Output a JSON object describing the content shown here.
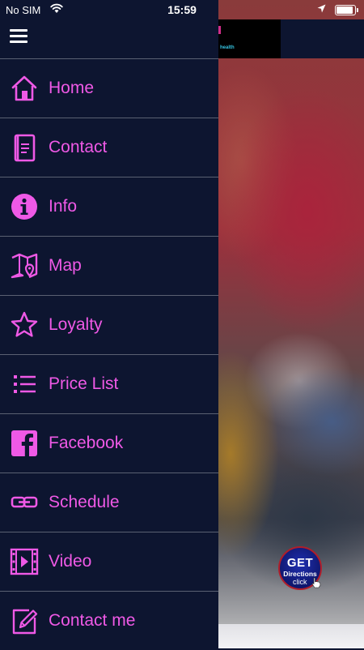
{
  "status_bar": {
    "carrier": "No SIM",
    "time": "15:59",
    "battery_level": 0.9
  },
  "header": {
    "logo_text": "health"
  },
  "drawer": {
    "menu_icon": "hamburger-menu-icon",
    "items": [
      {
        "label": "Home",
        "icon": "home-icon"
      },
      {
        "label": "Contact",
        "icon": "contact-card-icon"
      },
      {
        "label": "Info",
        "icon": "info-icon"
      },
      {
        "label": "Map",
        "icon": "map-icon"
      },
      {
        "label": "Loyalty",
        "icon": "star-icon"
      },
      {
        "label": "Price List",
        "icon": "list-icon"
      },
      {
        "label": "Facebook",
        "icon": "facebook-icon"
      },
      {
        "label": "Schedule",
        "icon": "link-icon"
      },
      {
        "label": "Video",
        "icon": "video-icon"
      },
      {
        "label": "Contact me",
        "icon": "edit-icon"
      }
    ]
  },
  "directions_button": {
    "line1": "GET",
    "line2": "Directions",
    "line3": "click"
  },
  "colors": {
    "drawer_bg": "#0d1530",
    "accent": "#ef59e6",
    "divider": "#5a6072"
  }
}
